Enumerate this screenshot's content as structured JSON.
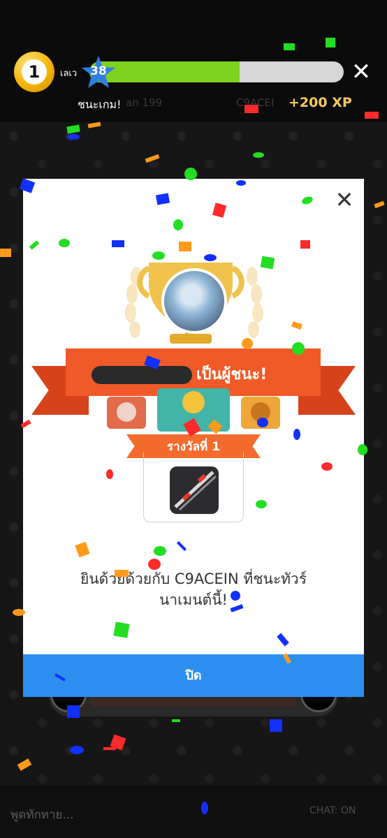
{
  "hud": {
    "level_number": "1",
    "level_label": "เลเว",
    "star_level": "38",
    "xp_progress": 0.59,
    "win_text": "ชนะเกม!",
    "ghost_left": "an 199",
    "ghost_right": "C9ACEI",
    "xp_gain": "+200 XP",
    "close_symbol": "✕"
  },
  "popup": {
    "close_symbol": "✕",
    "winner_suffix": "เป็นผู้ชนะ!",
    "rank_label": "รางวัลที่ 1",
    "congrats_text": "ยินด้วยด้วยกับ C9ACEIN ที่ชนะทัวร์นาเมนต์นี้!",
    "close_button": "ปิด"
  },
  "chat": {
    "placeholder": "พูดทักทาย...",
    "status": "CHAT: ON"
  },
  "colors": {
    "xp_fill": "#7ed321",
    "star": "#2f7fe0",
    "ribbon": "#f05a28",
    "button": "#2c8ff0",
    "xp_gain": "#f5c95a"
  },
  "icons": [
    "pool-ball-icon",
    "star-badge-icon",
    "close-icon",
    "trophy-icon",
    "cue-item-icon"
  ]
}
